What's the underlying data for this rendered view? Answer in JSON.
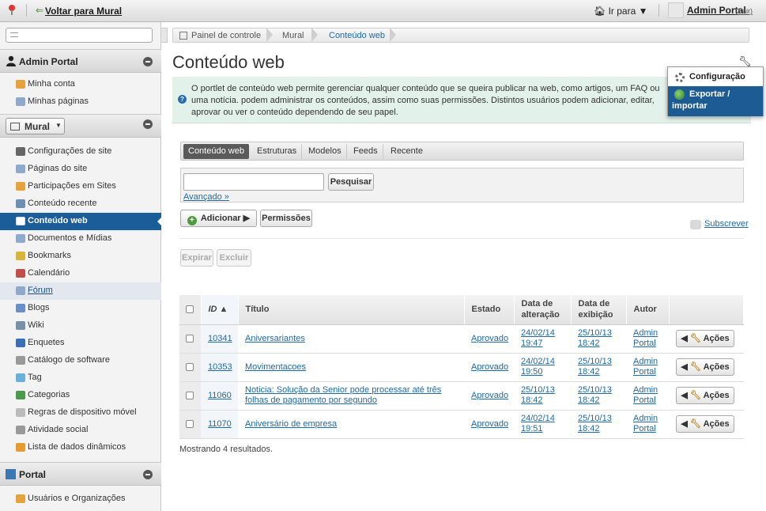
{
  "dockbar": {
    "back_label": "Voltar para Mural",
    "goto_label": "Ir para ▼",
    "user_name": "Admin Portal",
    "logout_label": "(Sair)"
  },
  "sidebar": {
    "admin_panel": {
      "title": "Admin Portal",
      "items": [
        {
          "label": "Minha conta",
          "icon": "user-icon"
        },
        {
          "label": "Minhas páginas",
          "icon": "pages-icon"
        }
      ]
    },
    "site_panel": {
      "site_selector": "Mural",
      "items": [
        {
          "label": "Configurações de site",
          "icon": "gear-icon"
        },
        {
          "label": "Páginas do site",
          "icon": "pages-icon"
        },
        {
          "label": "Participações em Sites",
          "icon": "users-icon"
        },
        {
          "label": "Conteúdo recente",
          "icon": "recent-icon"
        },
        {
          "label": "Conteúdo web",
          "icon": "web-content-icon"
        },
        {
          "label": "Documentos e Mídias",
          "icon": "documents-icon"
        },
        {
          "label": "Bookmarks",
          "icon": "bookmark-icon"
        },
        {
          "label": "Calendário",
          "icon": "calendar-icon"
        },
        {
          "label": "Fórum",
          "icon": "forum-icon"
        },
        {
          "label": "Blogs",
          "icon": "blogs-icon"
        },
        {
          "label": "Wiki",
          "icon": "wiki-icon"
        },
        {
          "label": "Enquetes",
          "icon": "poll-icon"
        },
        {
          "label": "Catálogo de software",
          "icon": "software-icon"
        },
        {
          "label": "Tag",
          "icon": "tag-icon"
        },
        {
          "label": "Categorias",
          "icon": "categories-icon"
        },
        {
          "label": "Regras de dispositivo móvel",
          "icon": "mobile-icon"
        },
        {
          "label": "Atividade social",
          "icon": "social-icon"
        },
        {
          "label": "Lista de dados dinâmicos",
          "icon": "list-icon"
        }
      ]
    },
    "portal_panel": {
      "title": "Portal",
      "items": [
        {
          "label": "Usuários e Organizações",
          "icon": "user-icon"
        }
      ]
    }
  },
  "breadcrumb": [
    "Painel de controle",
    "Mural",
    "Conteúdo web"
  ],
  "page": {
    "title": "Conteúdo web",
    "info": "O portlet de conteúdo web permite gerenciar qualquer conteúdo que se queira publicar na web, como artigos, um FAQ ou uma notícia. podem administrar os conteúdos, assim como suas permissões. Distintos usuários podem adicionar, editar, aprovar ou ver o conteúdo dependendo de seu papel."
  },
  "config_menu": {
    "item1": "Configuração",
    "item2_line1": "Exportar /",
    "item2_line2": "importar"
  },
  "tabs": [
    "Conteúdo web",
    "Estruturas",
    "Modelos",
    "Feeds",
    "Recente"
  ],
  "search": {
    "button": "Pesquisar",
    "advanced": "Avançado »",
    "value": ""
  },
  "actions": {
    "add": "Adicionar",
    "permissions": "Permissões",
    "subscribe": "Subscrever",
    "expire": "Expirar",
    "delete": "Excluir"
  },
  "table": {
    "headers": {
      "id": "ID ▲",
      "title": "Título",
      "status": "Estado",
      "modified": "Data de alteração",
      "display": "Data de exibição",
      "author": "Autor"
    },
    "rows": [
      {
        "id": "10341",
        "title": "Aniversariantes",
        "status": "Aprovado",
        "modified": "24/02/14 19:47",
        "display": "25/10/13 18:42",
        "author": "Admin Portal"
      },
      {
        "id": "10353",
        "title": "Movimentacoes",
        "status": "Aprovado",
        "modified": "24/02/14 19:50",
        "display": "25/10/13 18:42",
        "author": "Admin Portal"
      },
      {
        "id": "11060",
        "title": "Noticia: Solução da Senior pode processar até três folhas de pagamento por segundo",
        "status": "Aprovado",
        "modified": "25/10/13 18:42",
        "display": "25/10/13 18:42",
        "author": "Admin Portal"
      },
      {
        "id": "11070",
        "title": "Aniversário de empresa",
        "status": "Aprovado",
        "modified": "24/02/14 19:51",
        "display": "25/10/13 18:42",
        "author": "Admin Portal"
      }
    ],
    "row_action": "Ações",
    "footer": "Mostrando 4 resultados."
  },
  "colors": {
    "active_nav": "#1a5d99",
    "info_bg": "#e2f1ea",
    "link": "#1f6aa5"
  }
}
